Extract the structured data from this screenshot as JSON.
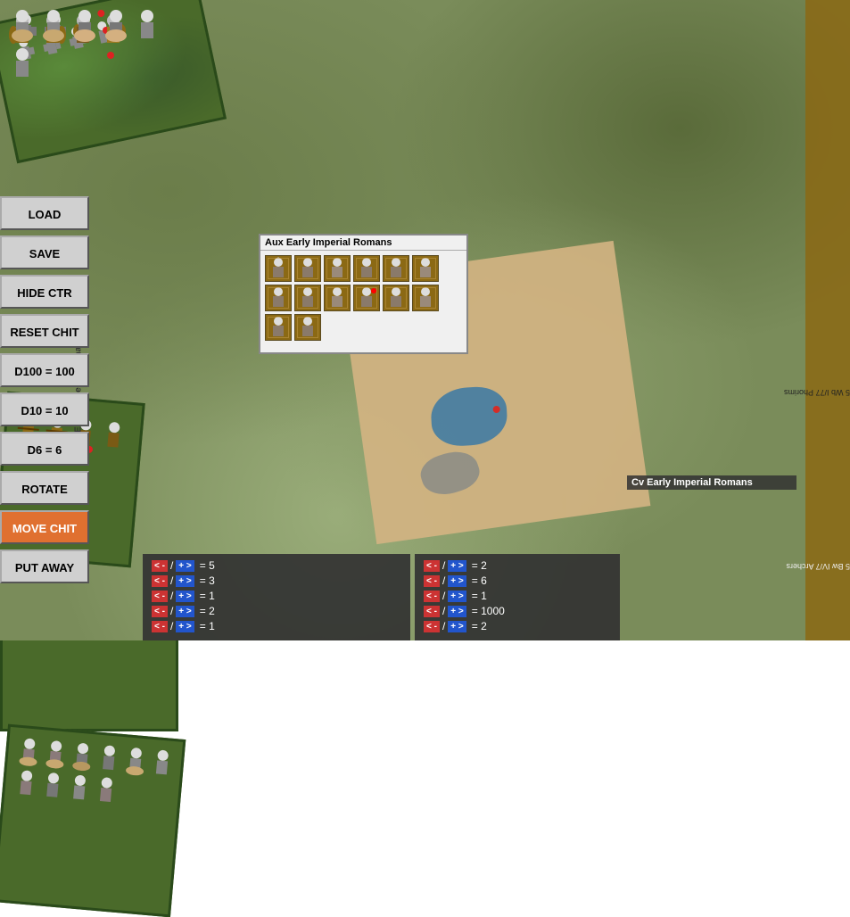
{
  "battlefield": {
    "background_color": "#7a8c5a"
  },
  "controls": {
    "load_label": "LOAD",
    "save_label": "SAVE",
    "hide_ctr_label": "HIDE CTR",
    "reset_chit_label": "RESET CHIT",
    "d100_label": "D100 = 100",
    "d10_label": "D10 = 10",
    "d6_label": "D6 = 6",
    "rotate_label": "ROTATE",
    "move_chit_label": "MOVE CHIT",
    "put_away_label": "PUT AWAY"
  },
  "aux_dialog": {
    "title": "Aux Early Imperial Romans",
    "token_count": 14
  },
  "cv_label": {
    "text": "Cv Early Imperial Romans"
  },
  "stats_left": {
    "rows": [
      {
        "minus": "< -",
        "plus": "+ >",
        "equals": "=",
        "value": "5"
      },
      {
        "minus": "< -",
        "plus": "+ >",
        "equals": "=",
        "value": "3"
      },
      {
        "minus": "< -",
        "plus": "+ >",
        "equals": "=",
        "value": "1"
      },
      {
        "minus": "< -",
        "plus": "+ >",
        "equals": "=",
        "value": "2"
      },
      {
        "minus": "< -",
        "plus": "+ >",
        "equals": "=",
        "value": "1"
      }
    ]
  },
  "stats_right": {
    "rows": [
      {
        "minus": "< -",
        "plus": "+ >",
        "equals": "=",
        "value": "2"
      },
      {
        "minus": "< -",
        "plus": "+ >",
        "equals": "=",
        "value": "6"
      },
      {
        "minus": "< -",
        "plus": "+ >",
        "equals": "=",
        "value": "1"
      },
      {
        "minus": "< -",
        "plus": "+ >",
        "equals": "=",
        "value": "1000"
      },
      {
        "minus": "< -",
        "plus": "+ >",
        "equals": "=",
        "value": "2"
      }
    ]
  },
  "side_labels": {
    "top_right": "5 Wb I/77 Phorims",
    "bottom_right": "5 Bw IV/7 Archers"
  },
  "diagonal_label": "Cv Early Imperial Romans"
}
